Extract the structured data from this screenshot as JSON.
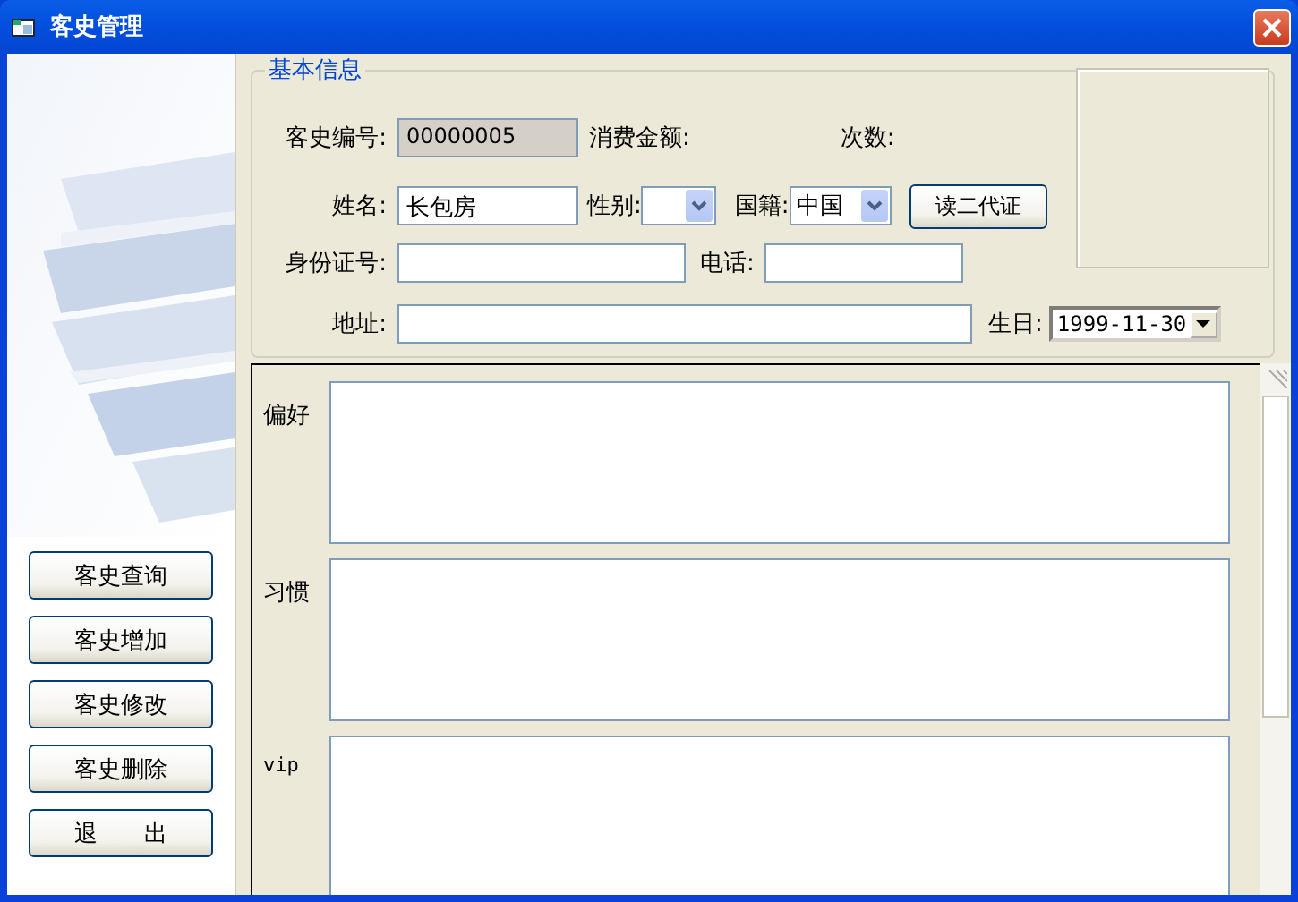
{
  "window": {
    "title": "客史管理"
  },
  "sidebar": {
    "buttons": [
      "客史查询",
      "客史增加",
      "客史修改",
      "客史删除",
      "退　　出"
    ]
  },
  "basic_info": {
    "legend": "基本信息",
    "customer_no": {
      "label": "客史编号:",
      "value": "00000005",
      "disabled": true
    },
    "amount": {
      "label": "消费金额:"
    },
    "visits": {
      "label": "次数:"
    },
    "name": {
      "label": "姓名:",
      "value": "长包房"
    },
    "gender": {
      "label": "性别:"
    },
    "nationality": {
      "label": "国籍:",
      "value": "中国"
    },
    "read_id_button": "读二代证",
    "id_number": {
      "label": "身份证号:"
    },
    "phone": {
      "label": "电话:"
    },
    "address": {
      "label": "地址:"
    },
    "birthday": {
      "label": "生日:",
      "value": "1999-11-30"
    }
  },
  "notes": [
    {
      "label": "偏好"
    },
    {
      "label": "习惯"
    },
    {
      "label": "vip"
    }
  ]
}
